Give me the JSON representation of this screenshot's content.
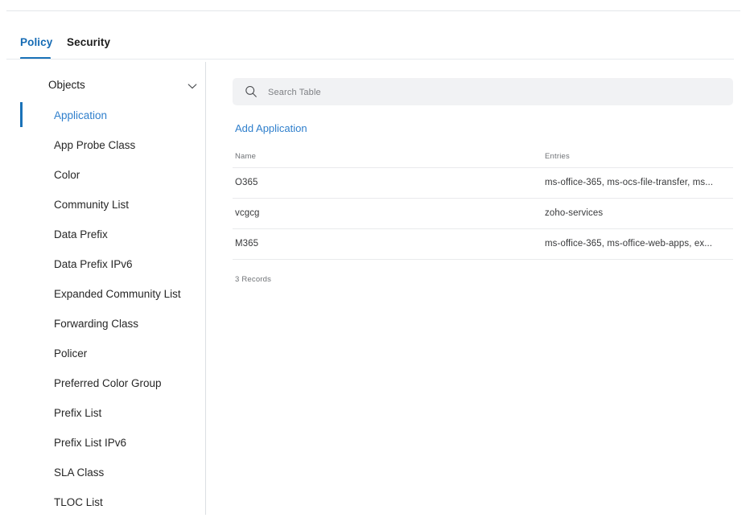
{
  "tabs": [
    {
      "label": "Policy",
      "active": true
    },
    {
      "label": "Security",
      "active": false
    }
  ],
  "sidebar": {
    "header": {
      "label": "Objects",
      "icon": "chevron-down-icon"
    },
    "items": [
      {
        "label": "Application",
        "active": true
      },
      {
        "label": "App Probe Class",
        "active": false
      },
      {
        "label": "Color",
        "active": false
      },
      {
        "label": "Community List",
        "active": false
      },
      {
        "label": "Data Prefix",
        "active": false
      },
      {
        "label": "Data Prefix IPv6",
        "active": false
      },
      {
        "label": "Expanded Community List",
        "active": false
      },
      {
        "label": "Forwarding Class",
        "active": false
      },
      {
        "label": "Policer",
        "active": false
      },
      {
        "label": "Preferred Color Group",
        "active": false
      },
      {
        "label": "Prefix List",
        "active": false
      },
      {
        "label": "Prefix List IPv6",
        "active": false
      },
      {
        "label": "SLA Class",
        "active": false
      },
      {
        "label": "TLOC List",
        "active": false
      }
    ]
  },
  "main": {
    "search": {
      "placeholder": "Search Table",
      "value": "",
      "icon": "search-icon"
    },
    "add_link": "Add Application",
    "table": {
      "columns": [
        "Name",
        "Entries"
      ],
      "rows": [
        {
          "name": "O365",
          "entries": "ms-office-365, ms-ocs-file-transfer, ms..."
        },
        {
          "name": "vcgcg",
          "entries": "zoho-services"
        },
        {
          "name": "M365",
          "entries": "ms-office-365, ms-office-web-apps, ex..."
        }
      ],
      "record_count": "3 Records"
    }
  },
  "colors": {
    "accent_blue": "#1a72b8",
    "link_blue": "#2f7fcc",
    "border": "#e9eaec",
    "search_bg": "#f1f2f4",
    "text": "#2b2b2b",
    "muted": "#6f7276"
  }
}
